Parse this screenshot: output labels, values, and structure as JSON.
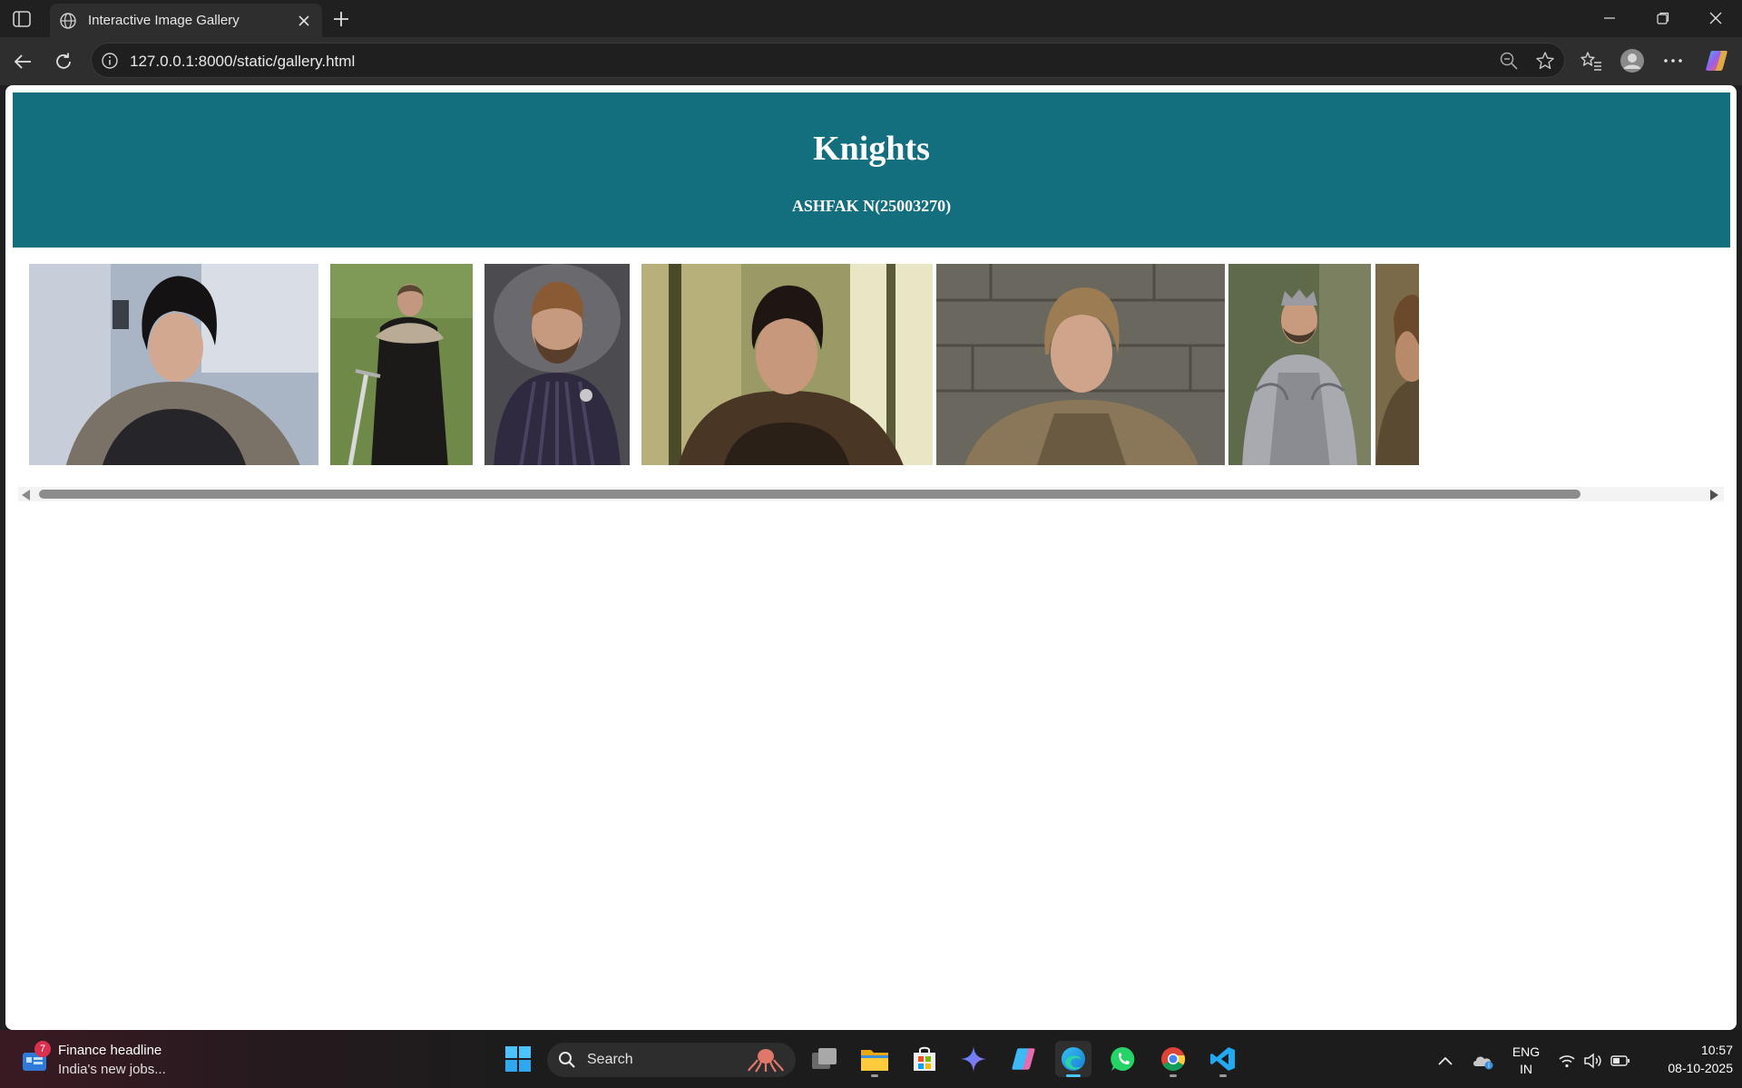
{
  "browser": {
    "tab_title": "Interactive Image Gallery",
    "url": "127.0.0.1:8000/static/gallery.html"
  },
  "page": {
    "title": "Knights",
    "subtitle": "ASHFAK N(25003270)",
    "header_color": "#136e7e",
    "gallery": [
      {
        "name": "photo-knight-1",
        "icon": "portrait-dark-curly-hair-fur-cloak"
      },
      {
        "name": "photo-knight-2",
        "icon": "portrait-standing-sword-fur-cloak"
      },
      {
        "name": "photo-knight-3",
        "icon": "portrait-beard-purple-doublet"
      },
      {
        "name": "photo-knight-4",
        "icon": "portrait-curly-hair-fur-forest"
      },
      {
        "name": "photo-knight-5",
        "icon": "portrait-blond-armor-stone-wall"
      },
      {
        "name": "photo-knight-6",
        "icon": "portrait-crowned-silver-armor"
      },
      {
        "name": "photo-knight-7",
        "icon": "portrait-partial-cut-off"
      }
    ]
  },
  "taskbar": {
    "widget_badge": "7",
    "widget_line1": "Finance headline",
    "widget_line2": "India's new jobs...",
    "search_label": "Search",
    "lang_line1": "ENG",
    "lang_line2": "IN",
    "time": "10:57",
    "date": "08-10-2025",
    "accent": "#4cc2ff"
  }
}
